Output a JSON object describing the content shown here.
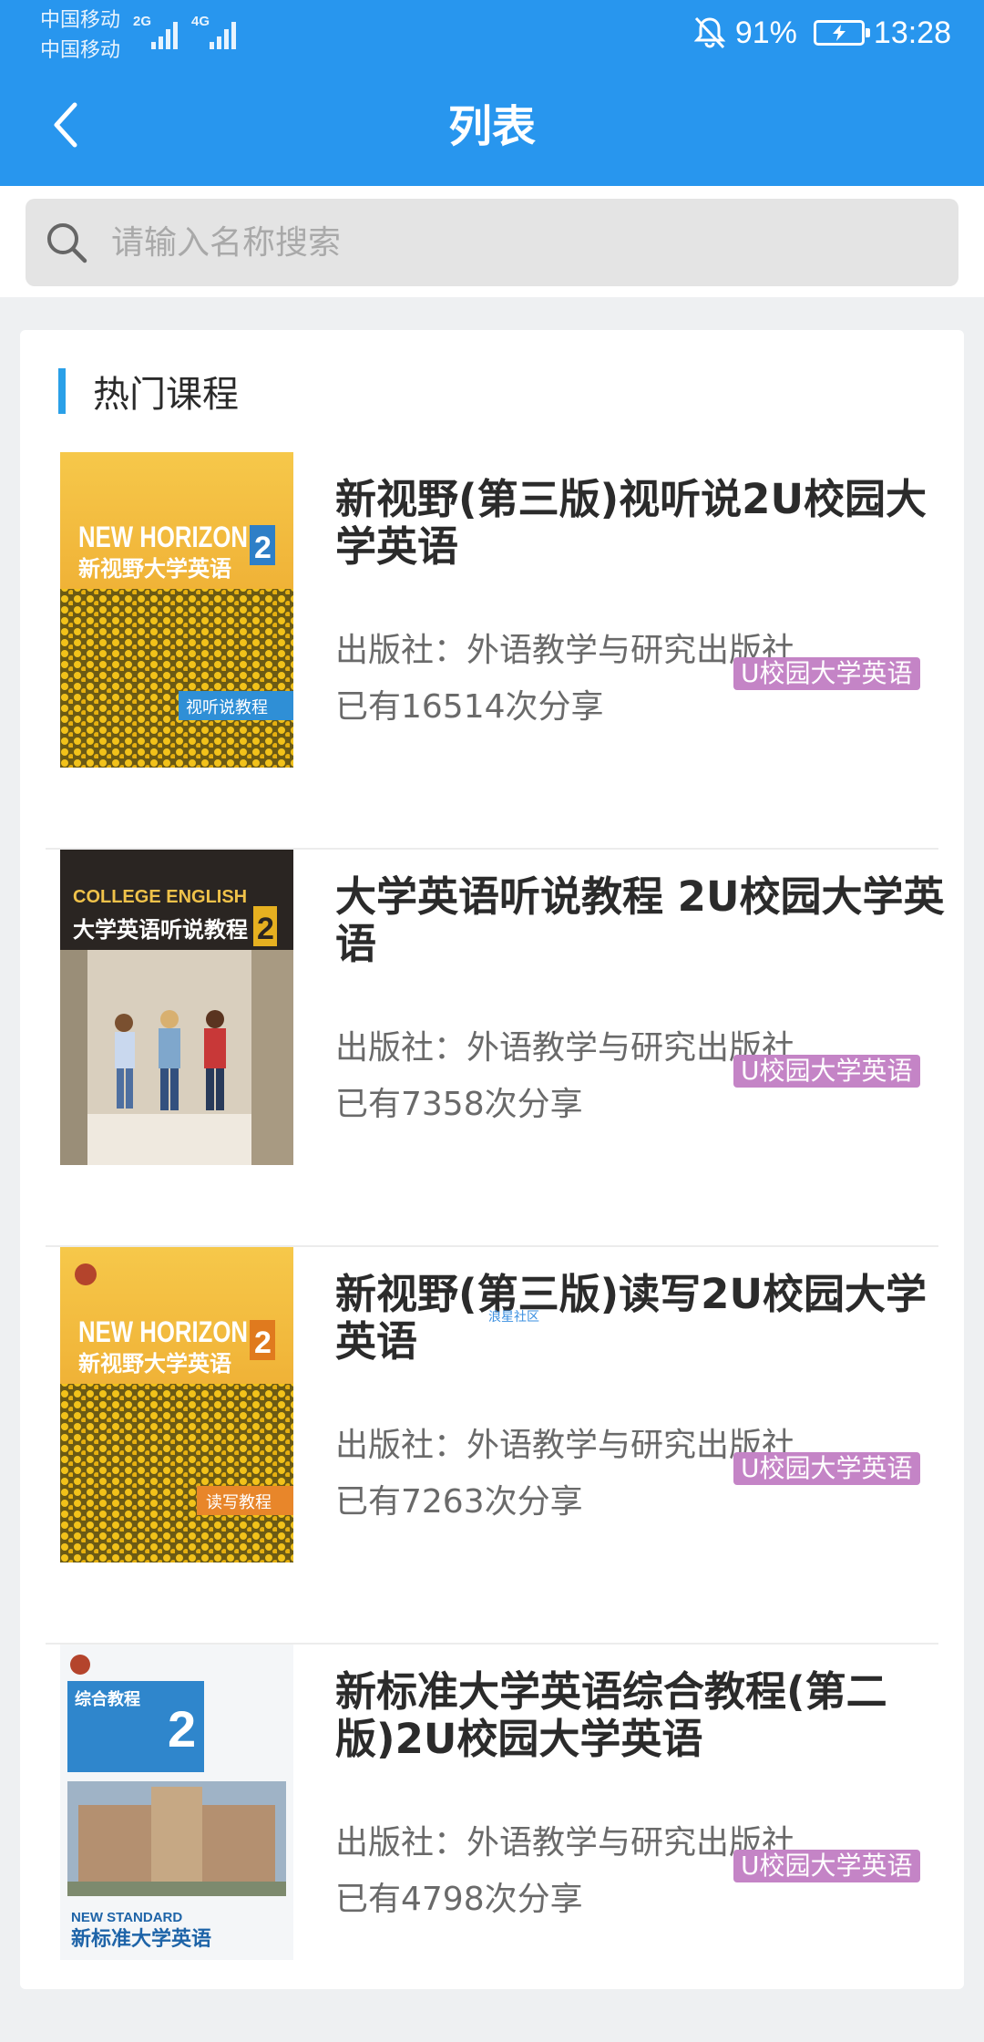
{
  "status_bar": {
    "carrier_1": "中国移动",
    "carrier_2": "中国移动",
    "net_1": "2G",
    "net_2": "4G",
    "battery": "91%",
    "time": "13:28"
  },
  "nav": {
    "title": "列表",
    "back_icon": "chevron-left-icon"
  },
  "search": {
    "placeholder": "请输入名称搜索",
    "icon": "search-icon"
  },
  "section": {
    "title": "热门课程"
  },
  "courses": [
    {
      "title": "新视野(第三版)视听说2U校园大学英语",
      "publisher": "出版社：外语教学与研究出版社",
      "shares": "已有16514次分享",
      "tag": "U校园大学英语",
      "cover": {
        "series": "NEW HORIZON",
        "name": "新视野大学英语",
        "volume": "2",
        "band": "视听说教程"
      }
    },
    {
      "title": "大学英语听说教程 2U校园大学英语",
      "publisher": "出版社：外语教学与研究出版社",
      "shares": "已有7358次分享",
      "tag": "U校园大学英语",
      "cover": {
        "series": "COLLEGE ENGLISH",
        "name": "大学英语听说教程",
        "volume": "2",
        "band": ""
      }
    },
    {
      "title": "新视野(第三版)读写2U校园大学英语",
      "publisher": "出版社：外语教学与研究出版社",
      "shares": "已有7263次分享",
      "tag": "U校园大学英语",
      "cover": {
        "series": "NEW HORIZON",
        "name": "新视野大学英语",
        "volume": "2",
        "band": "读写教程"
      }
    },
    {
      "title": "新标准大学英语综合教程(第二版)2U校园大学英语",
      "publisher": "出版社：外语教学与研究出版社",
      "shares": "已有4798次分享",
      "tag": "U校园大学英语",
      "cover": {
        "series": "NEW STANDARD",
        "name": "新标准大学英语",
        "volume": "2",
        "band": "综合教程"
      }
    }
  ],
  "watermark": "浪星社区",
  "colors": {
    "header": "#2896ee",
    "accent_bar": "#2aa0e8",
    "tag": "#c484c6",
    "background": "#eef0f2"
  }
}
